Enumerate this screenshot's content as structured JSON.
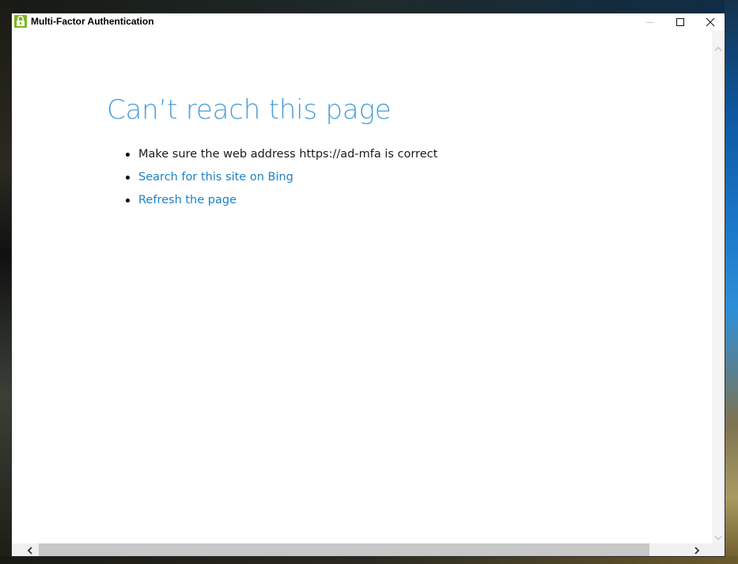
{
  "window": {
    "title": "Multi-Factor Authentication",
    "icon": "app-lock-icon",
    "controls": {
      "minimize": "minimize-icon",
      "maximize": "maximize-icon",
      "close": "close-icon"
    }
  },
  "error_page": {
    "title": "Can’t reach this page",
    "suggestions": [
      {
        "text": "Make sure the web address https://ad-mfa is correct",
        "is_link": false
      },
      {
        "text": "Search for this site on Bing",
        "is_link": true
      },
      {
        "text": "Refresh the page",
        "is_link": true
      }
    ]
  },
  "colors": {
    "title_blue": "#4a9fd8",
    "link_blue": "#1c82c9",
    "app_icon_green": "#7ab51d"
  },
  "scrollbars": {
    "horizontal_thumb_position": 0.04,
    "horizontal_thumb_fraction": 0.88
  }
}
